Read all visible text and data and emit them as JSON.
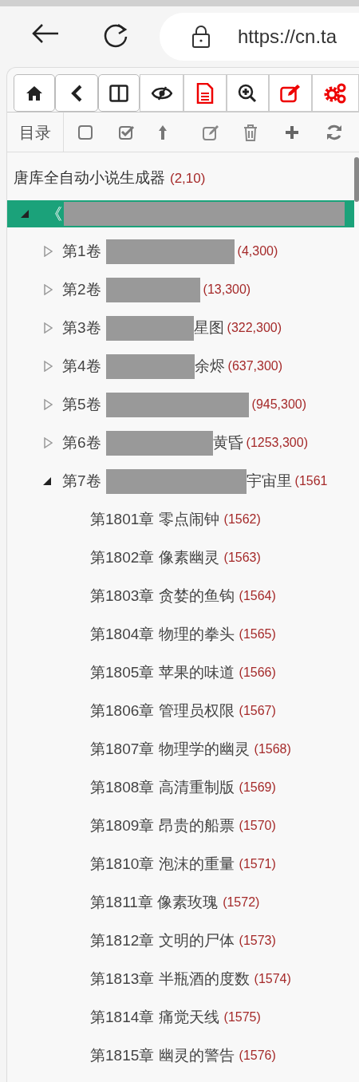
{
  "address_bar": {
    "url": "https://cn.ta"
  },
  "second_toolbar": {
    "label": "目录"
  },
  "tree": {
    "root": {
      "label": "唐库全自动小说生成器",
      "count": "(2,10)"
    },
    "book": {
      "prefix": "《",
      "selected": true,
      "expanded": true,
      "children": [
        {
          "label": "第1卷",
          "count": "(4,300)",
          "expanded": false
        },
        {
          "label": "第2卷",
          "count": "(13,300)",
          "expanded": false
        },
        {
          "label": "第3卷",
          "suffix": "星图",
          "count": "(322,300)",
          "expanded": false
        },
        {
          "label": "第4卷",
          "suffix": "余烬",
          "count": "(637,300)",
          "expanded": false
        },
        {
          "label": "第5卷",
          "count": "(945,300)",
          "expanded": false
        },
        {
          "label": "第6卷",
          "suffix": "黄昏",
          "count": "(1253,300)",
          "expanded": false
        },
        {
          "label": "第7卷",
          "suffix": "宇宙里",
          "count": "(1561",
          "expanded": true,
          "children": [
            {
              "label": "第1801章 零点闹钟",
              "count": "(1562)"
            },
            {
              "label": "第1802章 像素幽灵",
              "count": "(1563)"
            },
            {
              "label": "第1803章 贪婪的鱼钩",
              "count": "(1564)"
            },
            {
              "label": "第1804章 物理的拳头",
              "count": "(1565)"
            },
            {
              "label": "第1805章 苹果的味道",
              "count": "(1566)"
            },
            {
              "label": "第1806章 管理员权限",
              "count": "(1567)"
            },
            {
              "label": "第1807章 物理学的幽灵",
              "count": "(1568)"
            },
            {
              "label": "第1808章 高清重制版",
              "count": "(1569)"
            },
            {
              "label": "第1809章 昂贵的船票",
              "count": "(1570)"
            },
            {
              "label": "第1810章 泡沫的重量",
              "count": "(1571)"
            },
            {
              "label": "第1811章 像素玫瑰",
              "count": "(1572)"
            },
            {
              "label": "第1812章 文明的尸体",
              "count": "(1573)"
            },
            {
              "label": "第1813章 半瓶酒的度数",
              "count": "(1574)"
            },
            {
              "label": "第1814章 痛觉天线",
              "count": "(1575)"
            },
            {
              "label": "第1815章 幽灵的警告",
              "count": "(1576)"
            }
          ]
        }
      ]
    }
  }
}
